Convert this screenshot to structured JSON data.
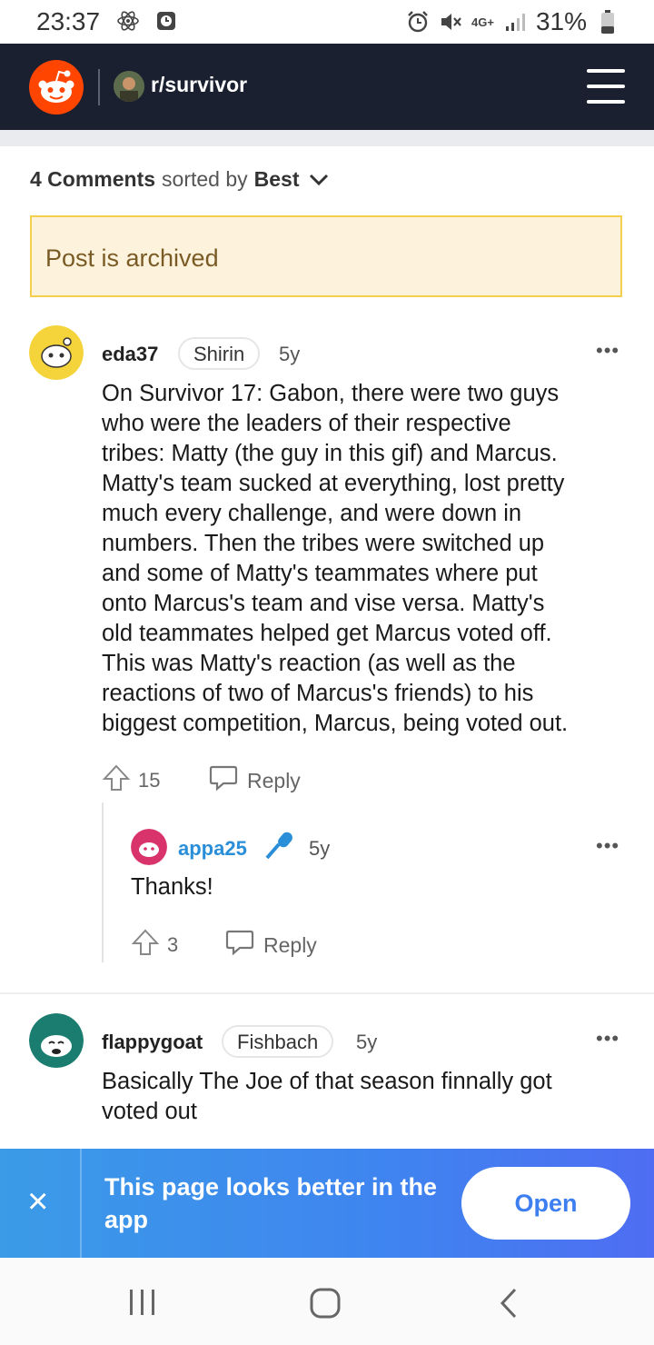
{
  "status": {
    "time": "23:37",
    "battery": "31%",
    "network": "4G+"
  },
  "header": {
    "subreddit": "r/survivor"
  },
  "sort": {
    "count_label": "4 Comments",
    "sorted_by": "sorted by",
    "sort_value": "Best"
  },
  "archived_notice": "Post is archived",
  "comments": [
    {
      "author": "eda37",
      "flair": "Shirin",
      "age": "5y",
      "more": "•••",
      "lines": [
        "On Survivor 17: Gabon, there were two guys",
        "who were the leaders of their respective",
        "tribes: Matty (the guy in this gif) and Marcus.",
        "Matty's team sucked at everything, lost pretty",
        "much every challenge, and were down in",
        "numbers. Then the tribes were switched up",
        "and some of Matty's teammates where put",
        "onto Marcus's team and vise versa. Matty's",
        "old teammates helped get Marcus voted off.",
        "This was Matty's reaction (as well as the",
        "reactions of two of Marcus's friends) to his",
        "biggest competition, Marcus, being voted out."
      ],
      "votes": "15",
      "reply": "Reply",
      "avatar_color": "#f5d33b"
    },
    {
      "author": "appa25",
      "age": "5y",
      "more": "•••",
      "body": "Thanks!",
      "votes": "3",
      "reply": "Reply",
      "author_color": "#2a8fd8",
      "avatar_color": "#d9336b"
    },
    {
      "author": "flappygoat",
      "flair": "Fishbach",
      "age": "5y",
      "more": "•••",
      "lines": [
        "Basically The Joe of that season finnally got",
        "voted out"
      ],
      "avatar_color": "#1a7d6f"
    }
  ],
  "banner": {
    "text": "This page looks better in the app",
    "open_label": "Open",
    "close_icon": "×"
  },
  "colors": {
    "header_bg": "#1a2030",
    "brand": "#ff4500",
    "banner": "#3f84f0",
    "archived_bg": "#fdf3dc",
    "archived_border": "#f3cf4b"
  }
}
